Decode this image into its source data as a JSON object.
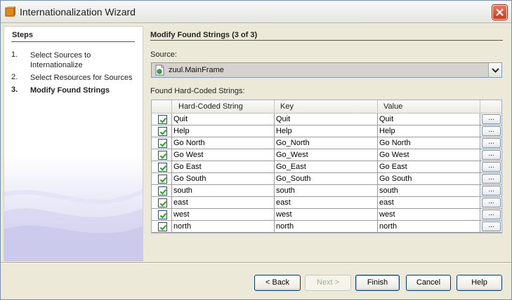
{
  "window": {
    "title": "Internationalization Wizard"
  },
  "steps": {
    "title": "Steps",
    "items": [
      {
        "num": "1.",
        "label": "Select Sources to Internationalize"
      },
      {
        "num": "2.",
        "label": "Select Resources for Sources"
      },
      {
        "num": "3.",
        "label": "Modify Found Strings"
      }
    ]
  },
  "main": {
    "title": "Modify Found Strings (3 of 3)",
    "source_label": "Source:",
    "source_value": "zuul.MainFrame",
    "found_label": "Found Hard-Coded Strings:",
    "columns": [
      "Hard-Coded String",
      "Key",
      "Value"
    ],
    "rows": [
      {
        "checked": true,
        "string": "Quit",
        "key": "Quit",
        "value": "Quit",
        "more": "..."
      },
      {
        "checked": true,
        "string": "Help",
        "key": "Help",
        "value": "Help",
        "more": "..."
      },
      {
        "checked": true,
        "string": "Go North",
        "key": "Go_North",
        "value": "Go North",
        "more": "..."
      },
      {
        "checked": true,
        "string": "Go West",
        "key": "Go_West",
        "value": "Go West",
        "more": "..."
      },
      {
        "checked": true,
        "string": "Go East",
        "key": "Go_East",
        "value": "Go East",
        "more": "..."
      },
      {
        "checked": true,
        "string": "Go South",
        "key": "Go_South",
        "value": "Go South",
        "more": "..."
      },
      {
        "checked": true,
        "string": "south",
        "key": "south",
        "value": "south",
        "more": "..."
      },
      {
        "checked": true,
        "string": "east",
        "key": "east",
        "value": "east",
        "more": "..."
      },
      {
        "checked": true,
        "string": "west",
        "key": "west",
        "value": "west",
        "more": "..."
      },
      {
        "checked": true,
        "string": "north",
        "key": "north",
        "value": "north",
        "more": "..."
      }
    ]
  },
  "buttons": {
    "back": "< Back",
    "next": "Next >",
    "finish": "Finish",
    "cancel": "Cancel",
    "help": "Help"
  },
  "colors": {
    "accent": "#003c74",
    "check": "#21a121",
    "close": "#c63b22"
  }
}
